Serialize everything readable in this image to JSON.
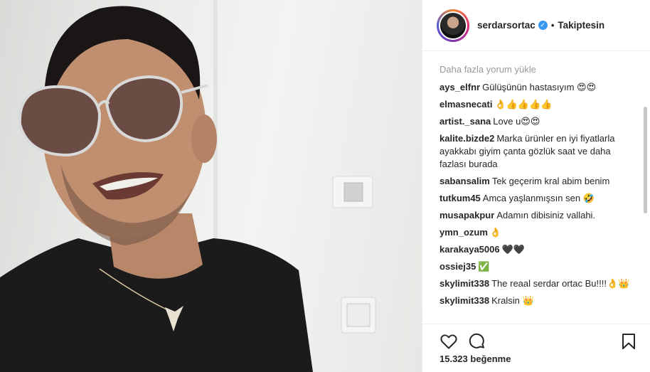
{
  "photo": {
    "alt_icon": "selfie-photo"
  },
  "header": {
    "username": "serdarsortac",
    "verified_icon": "verified-badge-icon",
    "separator": "•",
    "follow_state": "Takiptesin"
  },
  "comments": {
    "load_more": "Daha fazla yorum yükle",
    "items": [
      {
        "user": "ays_elfnr",
        "text": "Gülüşünün hastasıyım 😍😍"
      },
      {
        "user": "elmasnecati",
        "text": "👌👍👍👍👍"
      },
      {
        "user": "artist._sana",
        "text": "Love u😍😍"
      },
      {
        "user": "kalite.bizde2",
        "text": "Marka ürünler en iyi fiyatlarla ayakkabı giyim çanta gözlük saat ve daha fazlası burada"
      },
      {
        "user": "sabansalim",
        "text": "Tek geçerim kral abim benim"
      },
      {
        "user": "tutkum45",
        "text": "Amca yaşlanmışsın sen 🤣"
      },
      {
        "user": "musapakpur",
        "text": "Adamın dibisiniz vallahi."
      },
      {
        "user": "ymn_ozum",
        "text": "👌"
      },
      {
        "user": "karakaya5006",
        "text": "🖤🖤"
      },
      {
        "user": "ossiej35",
        "text": "✅"
      },
      {
        "user": "skylimit338",
        "text": "The reaal serdar ortac Bu!!!!👌👑"
      },
      {
        "user": "skylimit338",
        "text": "Kralsin 👑"
      }
    ]
  },
  "actions": {
    "like_icon": "heart-icon",
    "comment_icon": "comment-bubble-icon",
    "save_icon": "bookmark-icon"
  },
  "likes": {
    "text": "15.323 beğenme"
  }
}
